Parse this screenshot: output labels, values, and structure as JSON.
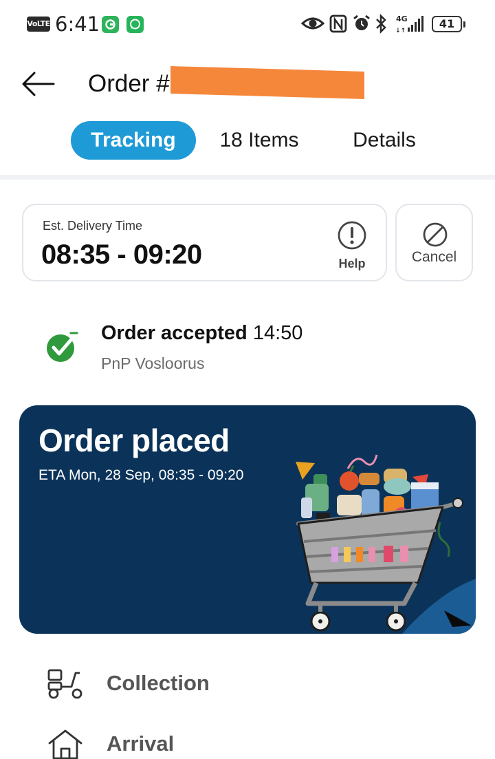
{
  "status_bar": {
    "network_badge": "VoLTE",
    "time": "6:41",
    "network_type": "4G",
    "battery": "41",
    "icons": [
      "eye-icon",
      "nfc-icon",
      "alarm-icon",
      "bluetooth-icon",
      "signal-icon"
    ]
  },
  "header": {
    "title": "Order #",
    "order_number_redacted": true
  },
  "tabs": [
    {
      "label": "Tracking",
      "active": true
    },
    {
      "label": "18 Items",
      "active": false
    },
    {
      "label": "Details",
      "active": false
    }
  ],
  "delivery": {
    "label": "Est. Delivery Time",
    "value": "08:35 - 09:20",
    "help_label": "Help",
    "cancel_label": "Cancel"
  },
  "status": {
    "title": "Order accepted",
    "time": "14:50",
    "store": "PnP Vosloorus"
  },
  "banner": {
    "title": "Order placed",
    "eta": "ETA Mon, 28 Sep, 08:35 - 09:20"
  },
  "steps": [
    {
      "label": "Collection",
      "icon": "scooter-icon"
    },
    {
      "label": "Arrival",
      "icon": "home-icon"
    }
  ],
  "colors": {
    "accent": "#1e9ad6",
    "banner_bg": "#0b3359",
    "success": "#2e9a3c",
    "redaction": "#f5873b"
  }
}
